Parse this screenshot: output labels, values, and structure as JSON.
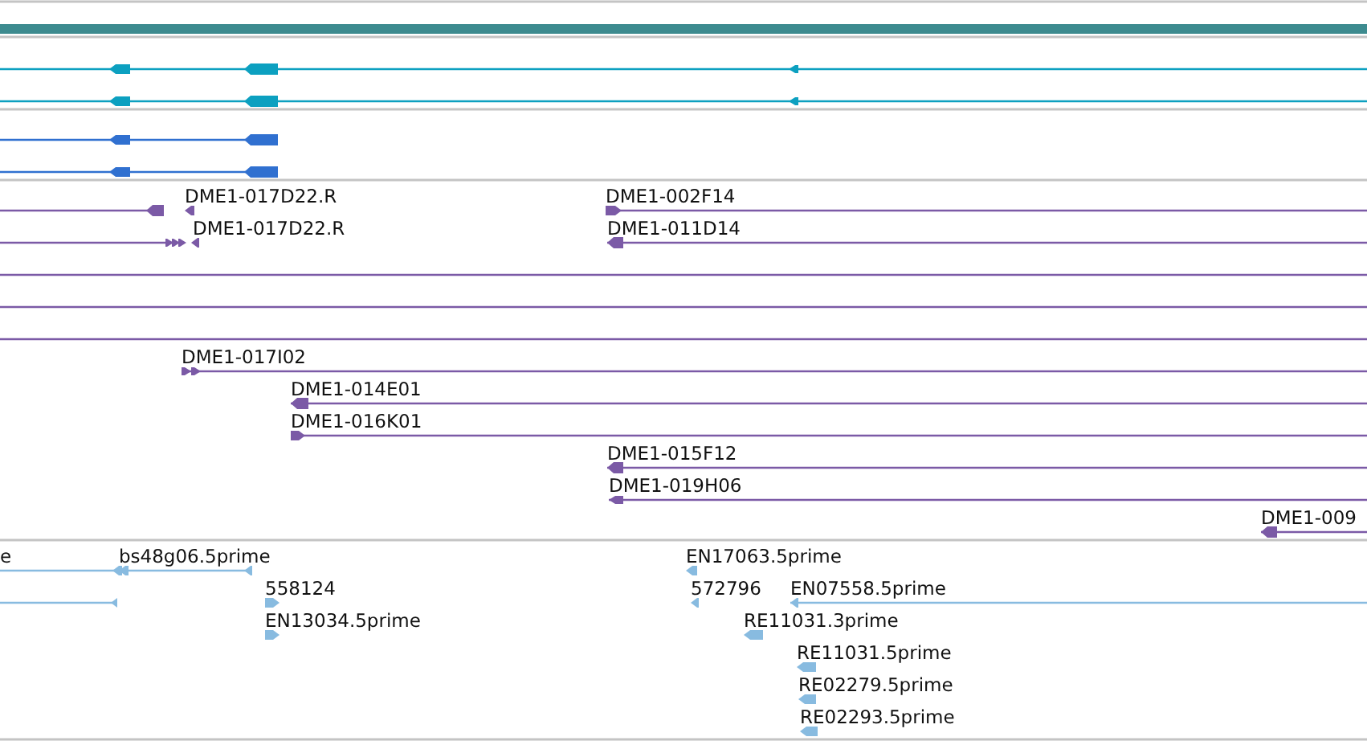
{
  "tracks": [
    {
      "kind": "bar",
      "color": "#3d8b8f"
    },
    {
      "kind": "features",
      "color": "#0ca0c0"
    },
    {
      "kind": "features",
      "color": "#3070d0"
    },
    {
      "kind": "features",
      "color": "#7b5aa6",
      "features": [
        {
          "label": "DME1-017D22.R"
        },
        {
          "label": "DME1-002F14"
        },
        {
          "label": "DME1-017D22.R"
        },
        {
          "label": "DME1-011D14"
        },
        {
          "label": "DME1-017I02"
        },
        {
          "label": "DME1-014E01"
        },
        {
          "label": "DME1-016K01"
        },
        {
          "label": "DME1-015F12"
        },
        {
          "label": "DME1-019H06"
        },
        {
          "label": "DME1-009"
        }
      ]
    },
    {
      "kind": "features",
      "color": "#88bbe0",
      "features": [
        {
          "label": "e"
        },
        {
          "label": "bs48g06.5prime"
        },
        {
          "label": "EN17063.5prime"
        },
        {
          "label": "558124"
        },
        {
          "label": "572796"
        },
        {
          "label": "EN07558.5prime"
        },
        {
          "label": "EN13034.5prime"
        },
        {
          "label": "RE11031.3prime"
        },
        {
          "label": "RE11031.5prime"
        },
        {
          "label": "RE02279.5prime"
        },
        {
          "label": "RE02293.5prime"
        }
      ]
    }
  ]
}
